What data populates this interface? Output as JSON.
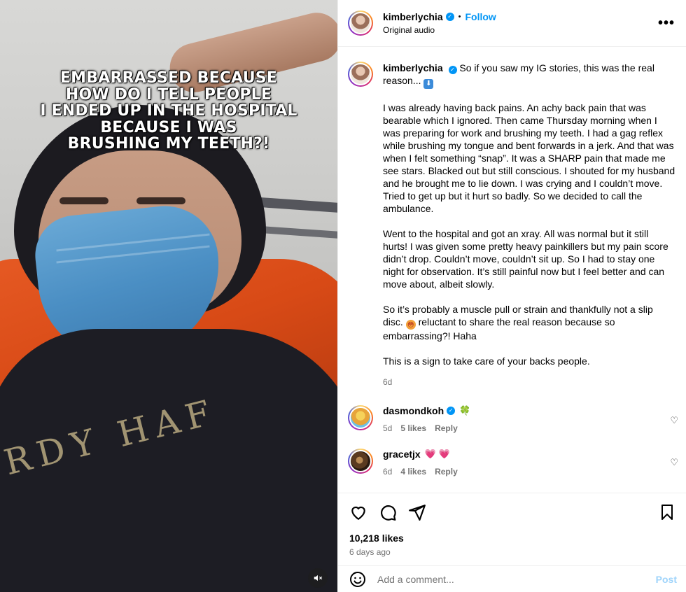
{
  "media": {
    "caption_lines": [
      "EMBARRASSED BECAUSE",
      "HOW DO I TELL PEOPLE",
      "I ENDED UP IN THE HOSPITAL",
      "BECAUSE I WAS",
      "BRUSHING MY TEETH?!"
    ],
    "shirt_text": "RDY HAF",
    "mute_icon": "speaker-muted-icon"
  },
  "header": {
    "username": "kimberlychia",
    "verified": "✓",
    "separator": "•",
    "follow_label": "Follow",
    "audio": "Original audio",
    "more_icon": "•••"
  },
  "post": {
    "username": "kimberlychia",
    "verified": "✓",
    "first_line": "So if you saw my IG stories, this was the real reason...",
    "down_emoji": "⬇",
    "paragraphs": [
      "I was already having back pains. An achy back pain that was bearable which I ignored. Then came Thursday morning when I was preparing for work and brushing my teeth. I had a gag reflex while brushing my tongue and bent forwards in a jerk. And that was when I felt something “snap”. It was a SHARP pain that made me see stars. Blacked out but still conscious. I shouted for my husband and he brought me to lie down. I was crying and I couldn’t move. Tried to get up but it hurt so badly. So we decided to call the ambulance.",
      "Went to the hospital and got an xray. All was normal but it still hurts! I was given some pretty heavy painkillers but my pain score didn’t drop. Couldn’t move, couldn’t sit up. So I had to stay one night for observation. It’s still painful now but I feel better and can move about, albeit slowly."
    ],
    "p3_before": "So it’s probably a muscle pull or strain and thankfully not a slip disc.",
    "flush_emoji": "😳",
    "p3_after": "reluctant to share the real reason because so embarrassing?! Haha",
    "p4": "This is a sign to take care of your backs people.",
    "time": "6d"
  },
  "comments": [
    {
      "username": "dasmondkoh",
      "verified": "✓",
      "emoji": "🍀",
      "time": "5d",
      "likes": "5 likes",
      "reply": "Reply"
    },
    {
      "username": "gracetjx",
      "emoji": "💗💗",
      "time": "6d",
      "likes": "4 likes",
      "reply": "Reply"
    }
  ],
  "actions": {
    "like_icon": "♡",
    "comment_icon": "◯",
    "share_icon": "➢",
    "save_icon": "⚐",
    "likes": "10,218 likes",
    "ago": "6 days ago"
  },
  "add_comment": {
    "emoji_icon": "☺",
    "placeholder": "Add a comment...",
    "post_label": "Post"
  },
  "colors": {
    "accent": "#0095f6",
    "muted_text": "#737373",
    "divider": "#efefef"
  }
}
